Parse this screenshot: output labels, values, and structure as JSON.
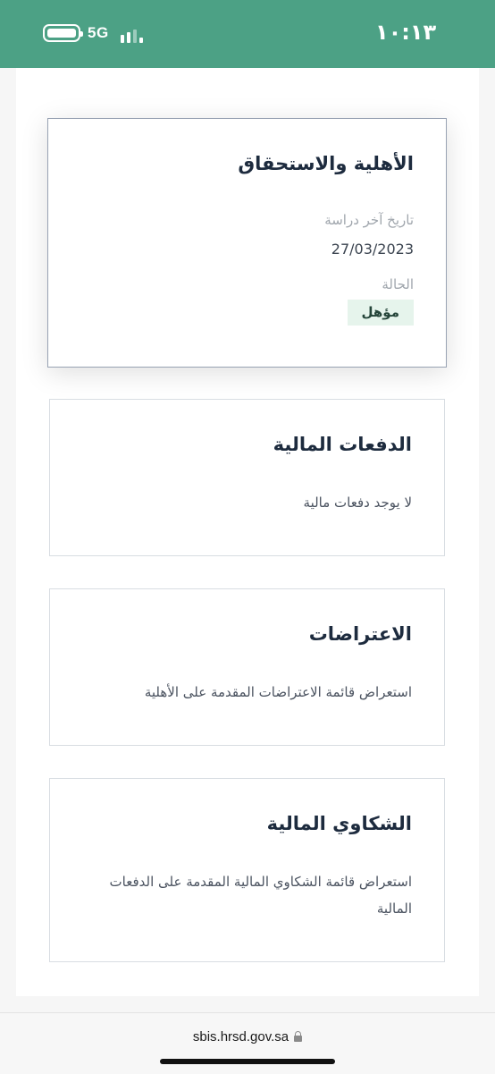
{
  "status_bar": {
    "network": "5G",
    "time": "١٠:١٣"
  },
  "cards": {
    "eligibility": {
      "title": "الأهلية والاستحقاق",
      "last_study_label": "تاريخ آخر دراسة",
      "last_study_value": "27/03/2023",
      "status_label": "الحالة",
      "status_value": "مؤهل"
    },
    "payments": {
      "title": "الدفعات المالية",
      "description": "لا يوجد دفعات مالية"
    },
    "objections": {
      "title": "الاعتراضات",
      "description": "استعراض قائمة الاعتراضات المقدمة على الأهلية"
    },
    "complaints": {
      "title": "الشكاوي المالية",
      "description": "استعراض قائمة الشكاوي المالية المقدمة على الدفعات المالية"
    }
  },
  "browser": {
    "url": "sbis.hrsd.gov.sa"
  }
}
